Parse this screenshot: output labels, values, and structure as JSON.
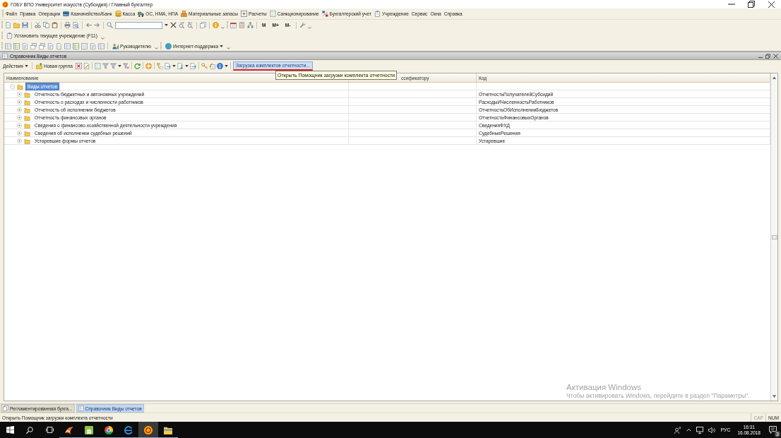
{
  "window": {
    "title": "ГОБУ ВПО Университет искусств (Субсидия) / Главный бухгалтер"
  },
  "menu": [
    {
      "label": "Файл",
      "kind": "text"
    },
    {
      "label": "Правка",
      "kind": "text"
    },
    {
      "label": "Операции",
      "kind": "text"
    },
    {
      "label": "Казначейство/Банк",
      "kind": "icon"
    },
    {
      "label": "Касса",
      "kind": "icon"
    },
    {
      "label": "ОС, НМА, НПА",
      "kind": "icon"
    },
    {
      "label": "Материальные запасы",
      "kind": "icon"
    },
    {
      "label": "Расчеты",
      "kind": "icon"
    },
    {
      "label": "Санкционирование",
      "kind": "icon"
    },
    {
      "label": "Бухгалтерский учет",
      "kind": "icon"
    },
    {
      "label": "Учреждение",
      "kind": "icon"
    },
    {
      "label": "Сервис",
      "kind": "text"
    },
    {
      "label": "Окна",
      "kind": "text"
    },
    {
      "label": "Справка",
      "kind": "text"
    }
  ],
  "toolbar_main": {
    "memory_buttons": [
      "М",
      "М+",
      "М-"
    ]
  },
  "toolbar_institution": {
    "button": "Установить текущее учреждение (F11)"
  },
  "toolbar_reports": {
    "buttons": [
      {
        "label": "Руководителю",
        "dropdown": false
      },
      {
        "label": "Интернет-поддержка",
        "dropdown": true
      }
    ]
  },
  "document_window": {
    "title": "Справочник Виды отчетов",
    "toolbar": {
      "actions": "Действия",
      "new_group": "Новая группа",
      "load_button": {
        "label": "Загрузка комплектов отчетности...",
        "hovered": true,
        "underlined": true
      }
    },
    "tooltip": "Открыть Помощник загрузки комплекта отчетности",
    "table": {
      "columns": [
        {
          "label": "Наименование"
        },
        {
          "label": "ссификатору"
        },
        {
          "label": "Код"
        }
      ],
      "rows": [
        {
          "name": "Виды отчетов",
          "selected": true,
          "expanded": true,
          "children": [
            {
              "name": "Отчетность бюджетных и автономных учреждений",
              "code": "ОтчетностьПолучателейСубсидий",
              "selected": false,
              "expanded": false
            },
            {
              "name": "Отчетность о расходах и численности работников",
              "code": "РасходыИЧисленностьРаботников",
              "selected": false,
              "expanded": false
            },
            {
              "name": "Отчетность об исполнении бюджетов",
              "code": "ОтчетностьОбИсполненииБюджетов",
              "selected": false,
              "expanded": false
            },
            {
              "name": "Отчетность финансовых органов",
              "code": "ОтчетностьФинансовыхОрганов",
              "selected": false,
              "expanded": false
            },
            {
              "name": "Сведения о финансово-хозяйственной деятельности учреждения",
              "code": "СведенияФХД",
              "selected": false,
              "expanded": false
            },
            {
              "name": "Сведения об исполнении судебных решений",
              "code": "СудебныеРешения",
              "selected": false,
              "expanded": false
            },
            {
              "name": "Устаревшие формы отчетов",
              "code": "Устаревшие",
              "selected": false,
              "expanded": false
            }
          ]
        }
      ]
    }
  },
  "window_tabs": [
    {
      "label": "Регламентированная бухга...",
      "selected": false
    },
    {
      "label": "Справочник Виды отчетов",
      "selected": true
    }
  ],
  "status_bar": {
    "text": "Открыть Помощник загрузки комплекта отчетности",
    "indicators": [
      {
        "label": "CAP",
        "on": false
      },
      {
        "label": "NUM",
        "on": true
      }
    ]
  },
  "activation": {
    "title": "Активация Windows",
    "text": "Чтобы активировать Windows, перейдите в раздел \"Параметры\"."
  },
  "taskbar": {
    "apps": [
      {
        "selected": false
      },
      {
        "selected": false
      },
      {
        "selected": false
      },
      {
        "selected": false
      },
      {
        "selected": true
      },
      {
        "selected": false
      }
    ],
    "language": "РУС",
    "time": "16:31",
    "date": "16.08.2018",
    "notifications": "3"
  }
}
